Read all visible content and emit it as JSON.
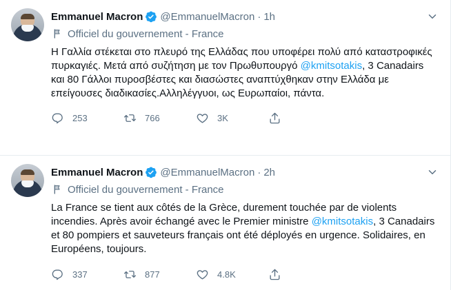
{
  "tweets": [
    {
      "author_name": "Emmanuel Macron",
      "handle": "@EmmanuelMacron",
      "separator": "·",
      "time": "1h",
      "label": "Officiel du gouvernement - France",
      "text_before": "Η Γαλλία στέκεται στο πλευρό της Ελλάδας που υποφέρει πολύ από καταστροφικές πυρκαγιές. Μετά από συζήτηση με τον Πρωθυπουργό ",
      "mention": "@kmitsotakis",
      "text_after": ", 3 Canadairs και 80 Γάλλοι πυροσβέστες και διασώστες αναπτύχθηκαν στην Ελλάδα με επείγουσες διαδικασίες.Αλληλέγγυοι, ως Ευρωπαίοι, πάντα.",
      "replies": "253",
      "retweets": "766",
      "likes": "3K"
    },
    {
      "author_name": "Emmanuel Macron",
      "handle": "@EmmanuelMacron",
      "separator": "·",
      "time": "2h",
      "label": "Officiel du gouvernement - France",
      "text_before": "La France se tient aux côtés de la Grèce, durement touchée par de violents incendies. Après avoir échangé avec le Premier ministre ",
      "mention": "@kmitsotakis",
      "text_after": ", 3 Canadairs et 80 pompiers et sauveteurs français ont été déployés en urgence. Solidaires, en Européens, toujours.",
      "replies": "337",
      "retweets": "877",
      "likes": "4.8K"
    }
  ],
  "icons": {
    "verified": "verified-badge-icon",
    "caret": "chevron-down-icon",
    "label": "flag-icon",
    "reply": "reply-icon",
    "retweet": "retweet-icon",
    "like": "heart-icon",
    "share": "share-icon"
  },
  "colors": {
    "accent": "#1da1f2",
    "secondary_text": "#5b7083",
    "primary_text": "#0f1419",
    "divider": "#e6ecf0"
  }
}
